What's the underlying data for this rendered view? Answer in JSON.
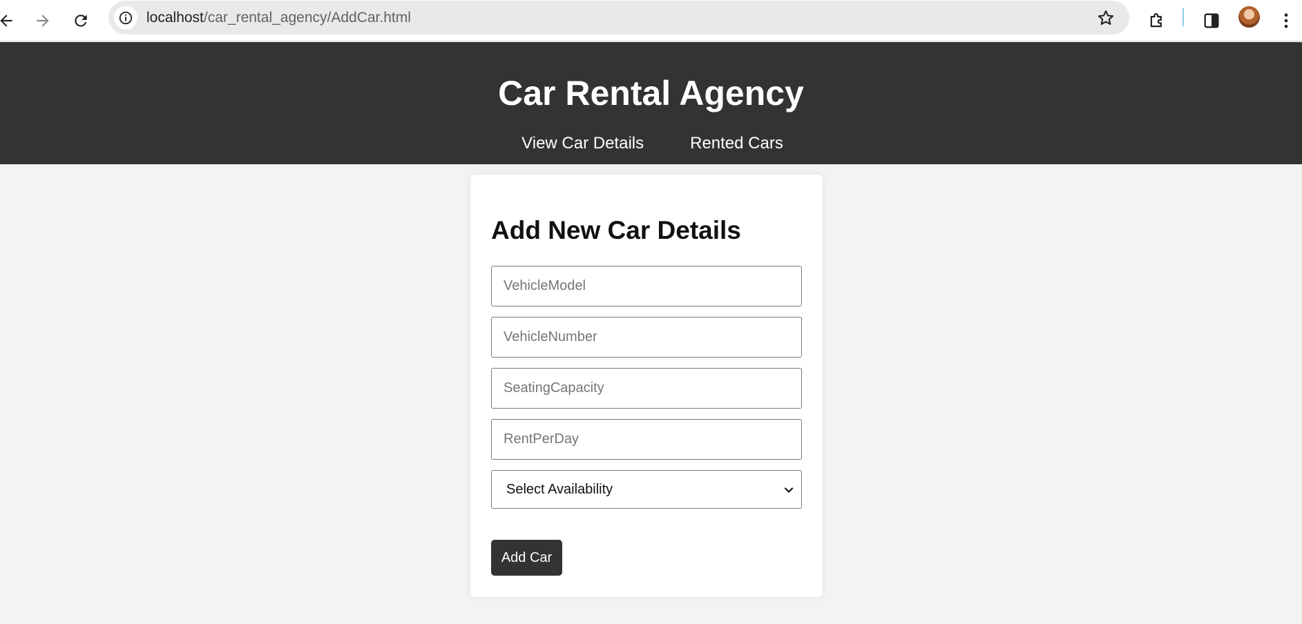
{
  "browser": {
    "url_host": "localhost",
    "url_path": "/car_rental_agency/AddCar.html",
    "icons": [
      "back-arrow-icon",
      "forward-arrow-icon",
      "reload-icon",
      "site-info-icon",
      "bookmark-star-icon",
      "extensions-icon",
      "side-panel-icon",
      "profile-avatar",
      "kebab-menu-icon"
    ]
  },
  "header": {
    "title": "Car Rental Agency",
    "nav": [
      {
        "label": "View Car Details"
      },
      {
        "label": "Rented Cars"
      }
    ],
    "background": "#333333"
  },
  "form": {
    "title": "Add New Car Details",
    "fields": [
      {
        "placeholder": "VehicleModel",
        "value": ""
      },
      {
        "placeholder": "VehicleNumber",
        "value": ""
      },
      {
        "placeholder": "SeatingCapacity",
        "value": ""
      },
      {
        "placeholder": "RentPerDay",
        "value": ""
      }
    ],
    "availability": {
      "selected": "Select Availability"
    },
    "submit_label": "Add Car"
  }
}
